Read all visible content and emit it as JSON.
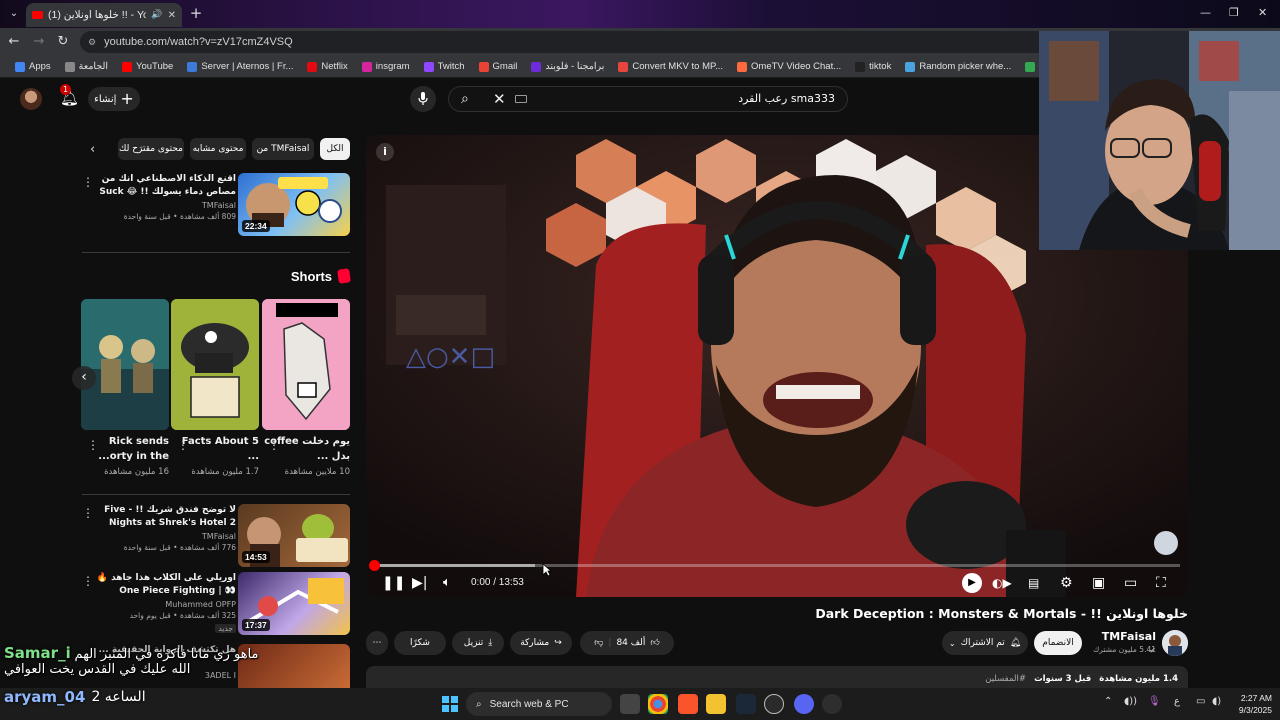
{
  "browser": {
    "tab_title": "(1) خلوها اونلاين !! - YouTube",
    "url": "youtube.com/watch?v=zV17cmZ4VSQ",
    "bookmarks": [
      {
        "label": "Apps",
        "color": "#4285f4"
      },
      {
        "label": "الجامعة",
        "color": "#888888"
      },
      {
        "label": "YouTube",
        "color": "#ff0000"
      },
      {
        "label": "Server | Aternos | Fr...",
        "color": "#3c7bd8"
      },
      {
        "label": "Netflix",
        "color": "#e50914"
      },
      {
        "label": "insgram",
        "color": "#d6249f"
      },
      {
        "label": "Twitch",
        "color": "#9146ff"
      },
      {
        "label": "Gmail",
        "color": "#ea4335"
      },
      {
        "label": "برامجنا - فلوبند",
        "color": "#6d2bd9"
      },
      {
        "label": "Convert MKV to MP...",
        "color": "#e8453c"
      },
      {
        "label": "OmeTV Video Chat...",
        "color": "#ff6a3d"
      },
      {
        "label": "tiktok",
        "color": "#222222"
      },
      {
        "label": "Random picker whe...",
        "color": "#4aa3df"
      },
      {
        "label": "Google خرائط",
        "color": "#34a853"
      }
    ]
  },
  "header": {
    "notification_count": "1",
    "create_label": "إنشاء",
    "search_query": "sma333 رعب القرد"
  },
  "sidebar": {
    "chips": [
      {
        "label": "الكل",
        "active": true
      },
      {
        "label": "من TMFaisal",
        "active": false
      },
      {
        "label": "محتوى مشابه",
        "active": false
      },
      {
        "label": "محتوى مقترَح لك",
        "active": false
      }
    ],
    "top_video": {
      "title": "اقنع الذكاء الاصطناعي انك من مصاص دماء يسولك !! 😂 Suck Up",
      "channel": "TMFaisal",
      "stats": "809 ألف مشاهدة • قبل سنة واحدة",
      "duration": "22:34"
    },
    "shorts_label": "Shorts",
    "shorts": [
      {
        "title": "يوم دخلت coffee بدل ...",
        "views": "10 ملايين مشاهدة"
      },
      {
        "title": "5 Facts About ...",
        "views": "1.7 مليون مشاهدة"
      },
      {
        "title": "Rick sends ...orty in the",
        "views": "16 مليون مشاهدة"
      }
    ],
    "videos": [
      {
        "title": "لا توضح فندق شريك !! - Five Nights at Shrek's Hotel 2",
        "channel": "TMFaisal",
        "stats": "776 ألف مشاهدة • قبل سنة واحدة",
        "duration": "14:53"
      },
      {
        "title": "اوريلي على الكلاب هذا جاهد 🔥 👀 | One Piece Fighting Path",
        "channel": "Muhammed OPFP",
        "stats": "325 ألف مشاهدة • قبل يوم واحد",
        "badge": "جديد",
        "duration": "17:37"
      },
      {
        "title": "هل تكتشف الرواية الحقيقية ...",
        "channel": "3ADEL I",
        "stats": "",
        "duration": ""
      }
    ]
  },
  "player": {
    "time": "0:00 / 13:53",
    "progress_fraction": 0.0,
    "buffered_fraction": 0.2
  },
  "video": {
    "title": "خلوها اونلاين !! - Dark Deception : Monsters & Mortals",
    "channel": "TMFaisal",
    "subscribers": "5.41 مليون مشترك",
    "subscribe_label": "الانضمام",
    "subscribed_label": "تم الاشتراك",
    "likes": "84 ألف",
    "share_label": "مشاركة",
    "download_label": "تنزيل",
    "thanks_label": "شكرًا",
    "description": {
      "views": "1.4 مليون مشاهدة",
      "age": "قبل 3 سنوات",
      "tag": "#المفسلين"
    }
  },
  "chat": [
    {
      "user": "Samar_i",
      "text": "ماهو زي مانا فاكره في المنبر الهم الله عليك في القدس يخت العوافي"
    },
    {
      "user": "aryam_04",
      "text": "الساعه 2"
    }
  ],
  "taskbar": {
    "search_placeholder": "Search web & PC",
    "time": "2:27 AM",
    "date": "9/3/2025"
  }
}
